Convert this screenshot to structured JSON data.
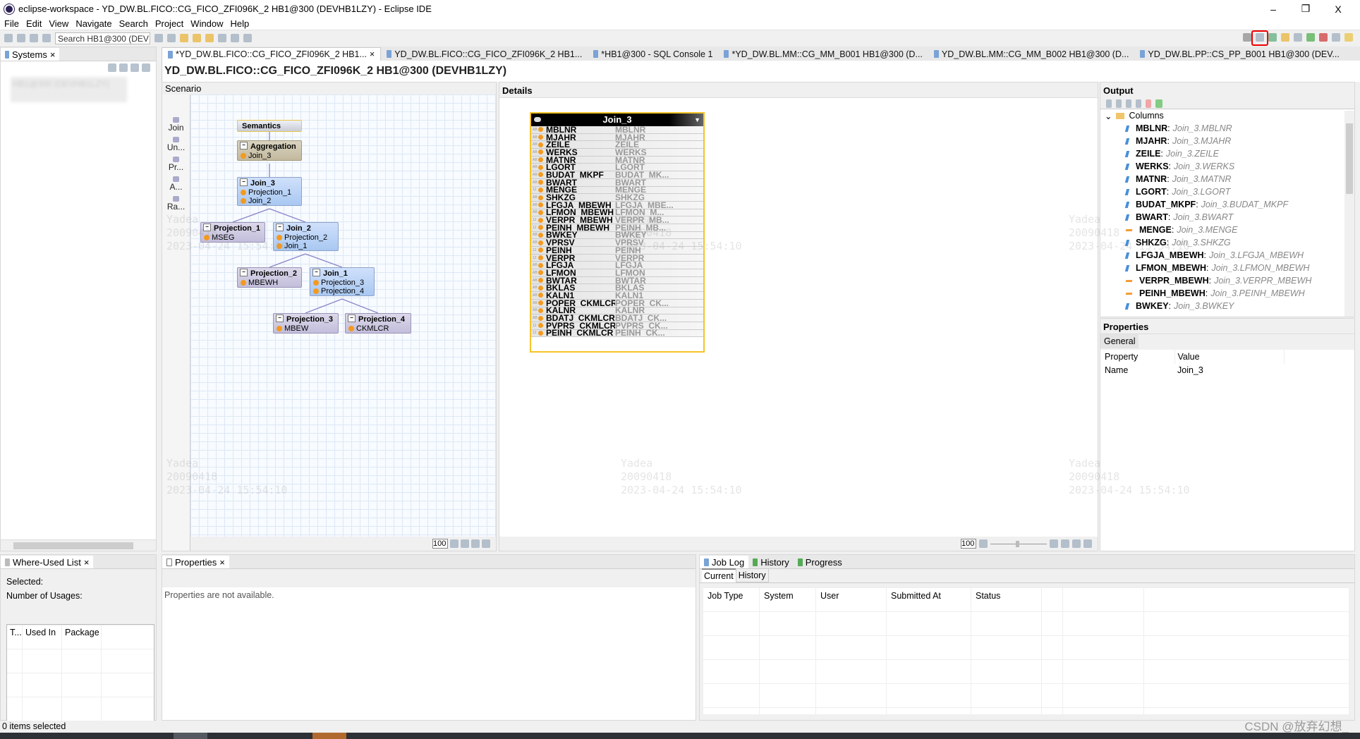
{
  "window": {
    "title": "eclipse-workspace - YD_DW.BL.FICO::CG_FICO_ZFI096K_2 HB1@300 (DEVHB1LZY)  - Eclipse IDE",
    "minimize": "–",
    "restore": "❐",
    "close": "X"
  },
  "menu": [
    "File",
    "Edit",
    "View",
    "Navigate",
    "Search",
    "Project",
    "Window",
    "Help"
  ],
  "toolbar": {
    "search_value": "Search HB1@300 (DEV",
    "highlighted_button": "highlighted-toolbar-icon"
  },
  "systems": {
    "tab": "Systems",
    "blurred_item": "HB1@300 (DEVHB1LZY)"
  },
  "editor_tabs": [
    "*YD_DW.BL.FICO::CG_FICO_ZFI096K_2 HB1...",
    "YD_DW.BL.FICO::CG_FICO_ZFI096K_2 HB1...",
    "*HB1@300 - SQL Console 1",
    "*YD_DW.BL.MM::CG_MM_B001 HB1@300 (D...",
    "YD_DW.BL.MM::CG_MM_B002 HB1@300 (D...",
    "YD_DW.BL.PP::CS_PP_B001 HB1@300 (DEV..."
  ],
  "editor_title": "YD_DW.BL.FICO::CG_FICO_ZFI096K_2 HB1@300 (DEVHB1LZY)",
  "scenario": {
    "title": "Scenario",
    "palette": [
      "Join",
      "Un...",
      "Pr...",
      "A...",
      "Ra..."
    ],
    "zoom": "100",
    "nodes": {
      "semantics": "Semantics",
      "aggregation": {
        "name": "Aggregation",
        "inputs": [
          "Join_3"
        ]
      },
      "join3": {
        "name": "Join_3",
        "inputs": [
          "Projection_1",
          "Join_2"
        ]
      },
      "projection1": {
        "name": "Projection_1",
        "inputs": [
          "MSEG"
        ]
      },
      "join2": {
        "name": "Join_2",
        "inputs": [
          "Projection_2",
          "Join_1"
        ]
      },
      "projection2": {
        "name": "Projection_2",
        "inputs": [
          "MBEWH"
        ]
      },
      "join1": {
        "name": "Join_1",
        "inputs": [
          "Projection_3",
          "Projection_4"
        ]
      },
      "projection3": {
        "name": "Projection_3",
        "inputs": [
          "MBEW"
        ]
      },
      "projection4": {
        "name": "Projection_4",
        "inputs": [
          "CKMLCR"
        ]
      }
    }
  },
  "details": {
    "title": "Details",
    "zoom": "100",
    "box_title": "Join_3",
    "rows": [
      [
        "AB",
        "MBLNR",
        "MBLNR"
      ],
      [
        "AB",
        "MJAHR",
        "MJAHR"
      ],
      [
        "AB",
        "ZEILE",
        "ZEILE"
      ],
      [
        "AB",
        "WERKS",
        "WERKS"
      ],
      [
        "AB",
        "MATNR",
        "MATNR"
      ],
      [
        "AB",
        "LGORT",
        "LGORT"
      ],
      [
        "AB",
        "BUDAT_MKPF",
        "BUDAT_MK..."
      ],
      [
        "AB",
        "BWART",
        "BWART"
      ],
      [
        "12",
        "MENGE",
        "MENGE"
      ],
      [
        "AB",
        "SHKZG",
        "SHKZG"
      ],
      [
        "AB",
        "LFGJA_MBEWH",
        "LFGJA_MBE..."
      ],
      [
        "AB",
        "LFMON_MBEWH",
        "LFMON_M..."
      ],
      [
        "12",
        "VERPR_MBEWH",
        "VERPR_MB..."
      ],
      [
        "12",
        "PEINH_MBEWH",
        "PEINH_MB..."
      ],
      [
        "AB",
        "BWKEY",
        "BWKEY"
      ],
      [
        "AB",
        "VPRSV",
        "VPRSV"
      ],
      [
        "12",
        "PEINH",
        "PEINH"
      ],
      [
        "12",
        "VERPR",
        "VERPR"
      ],
      [
        "AB",
        "LFGJA",
        "LFGJA"
      ],
      [
        "AB",
        "LFMON",
        "LFMON"
      ],
      [
        "AB",
        "BWTAR",
        "BWTAR"
      ],
      [
        "AB",
        "BKLAS",
        "BKLAS"
      ],
      [
        "AB",
        "KALN1",
        "KALN1"
      ],
      [
        "AB",
        "POPER_CKMLCR",
        "POPER_CK..."
      ],
      [
        "AB",
        "KALNR",
        "KALNR"
      ],
      [
        "AB",
        "BDATJ_CKMLCR",
        "BDATJ_CK..."
      ],
      [
        "12",
        "PVPRS_CKMLCR",
        "PVPRS_CK..."
      ],
      [
        "12",
        "PEINH_CKMLCR",
        "PEINH_CK..."
      ]
    ]
  },
  "output": {
    "title": "Output",
    "root": "Columns",
    "items": [
      [
        "MBLNR",
        "Join_3.MBLNR",
        "attr"
      ],
      [
        "MJAHR",
        "Join_3.MJAHR",
        "attr"
      ],
      [
        "ZEILE",
        "Join_3.ZEILE",
        "attr"
      ],
      [
        "WERKS",
        "Join_3.WERKS",
        "attr"
      ],
      [
        "MATNR",
        "Join_3.MATNR",
        "attr"
      ],
      [
        "LGORT",
        "Join_3.LGORT",
        "attr"
      ],
      [
        "BUDAT_MKPF",
        "Join_3.BUDAT_MKPF",
        "attr"
      ],
      [
        "BWART",
        "Join_3.BWART",
        "attr"
      ],
      [
        "MENGE",
        "Join_3.MENGE",
        "measure"
      ],
      [
        "SHKZG",
        "Join_3.SHKZG",
        "attr"
      ],
      [
        "LFGJA_MBEWH",
        "Join_3.LFGJA_MBEWH",
        "attr"
      ],
      [
        "LFMON_MBEWH",
        "Join_3.LFMON_MBEWH",
        "attr"
      ],
      [
        "VERPR_MBEWH",
        "Join_3.VERPR_MBEWH",
        "measure"
      ],
      [
        "PEINH_MBEWH",
        "Join_3.PEINH_MBEWH",
        "measure"
      ],
      [
        "BWKEY",
        "Join_3.BWKEY",
        "attr"
      ]
    ]
  },
  "properties_right": {
    "title": "Properties",
    "tab": "General",
    "headers": [
      "Property",
      "Value"
    ],
    "rows": [
      [
        "Name",
        "Join_3"
      ]
    ]
  },
  "where_used": {
    "tab": "Where-Used List",
    "selected": "Selected:",
    "usages": "Number of Usages:",
    "columns": [
      "T...",
      "Used In",
      "Package"
    ]
  },
  "properties_bottom": {
    "tab": "Properties",
    "message": "Properties are not available."
  },
  "job_log": {
    "tabs": [
      "Job Log",
      "History",
      "Progress"
    ],
    "subtabs": [
      "Current",
      "History"
    ],
    "columns": [
      "Job Type",
      "System",
      "User",
      "Submitted At",
      "Status"
    ]
  },
  "status": {
    "text": "0 items selected",
    "watermark_csdn": "CSDN @放弃幻想_"
  },
  "watermark": {
    "line1": "Yadea",
    "line2": "20090418",
    "line3": "2023-04-24 15:54:10"
  },
  "colors": {
    "highlight": "#e00000",
    "join_node": "#a9c8f2",
    "projection_node": "#c3bedb",
    "aggregation_node": "#c2b99e",
    "selection": "#f6c328"
  }
}
